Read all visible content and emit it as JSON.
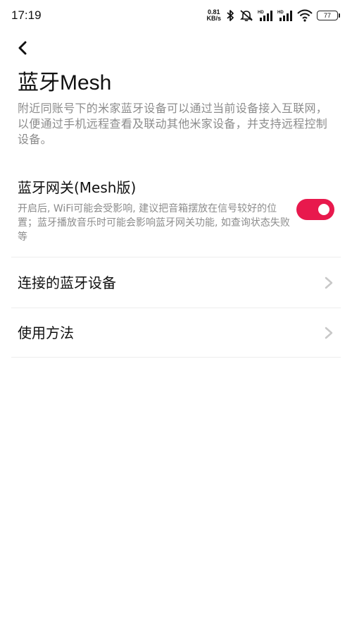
{
  "status_bar": {
    "time": "17:19",
    "net_speed_value": "0.81",
    "net_speed_unit": "KB/s",
    "battery_level": "77",
    "signal_1_label": "HD",
    "signal_2_label": "HD"
  },
  "header": {
    "back_icon": "chevron-left-icon",
    "title": "蓝牙Mesh",
    "description": "附近同账号下的米家蓝牙设备可以通过当前设备接入互联网，以便通过手机远程查看及联动其他米家设备，并支持远程控制设备。"
  },
  "settings": {
    "gateway": {
      "label": "蓝牙网关(Mesh版)",
      "description": "开启后, WiFi可能会受影响, 建议把音箱摆放在信号较好的位置；蓝牙播放音乐时可能会影响蓝牙网关功能, 如查询状态失败等",
      "enabled": true,
      "accent_color": "#e8194d"
    },
    "connected_devices": {
      "label": "连接的蓝牙设备"
    },
    "usage": {
      "label": "使用方法"
    }
  }
}
